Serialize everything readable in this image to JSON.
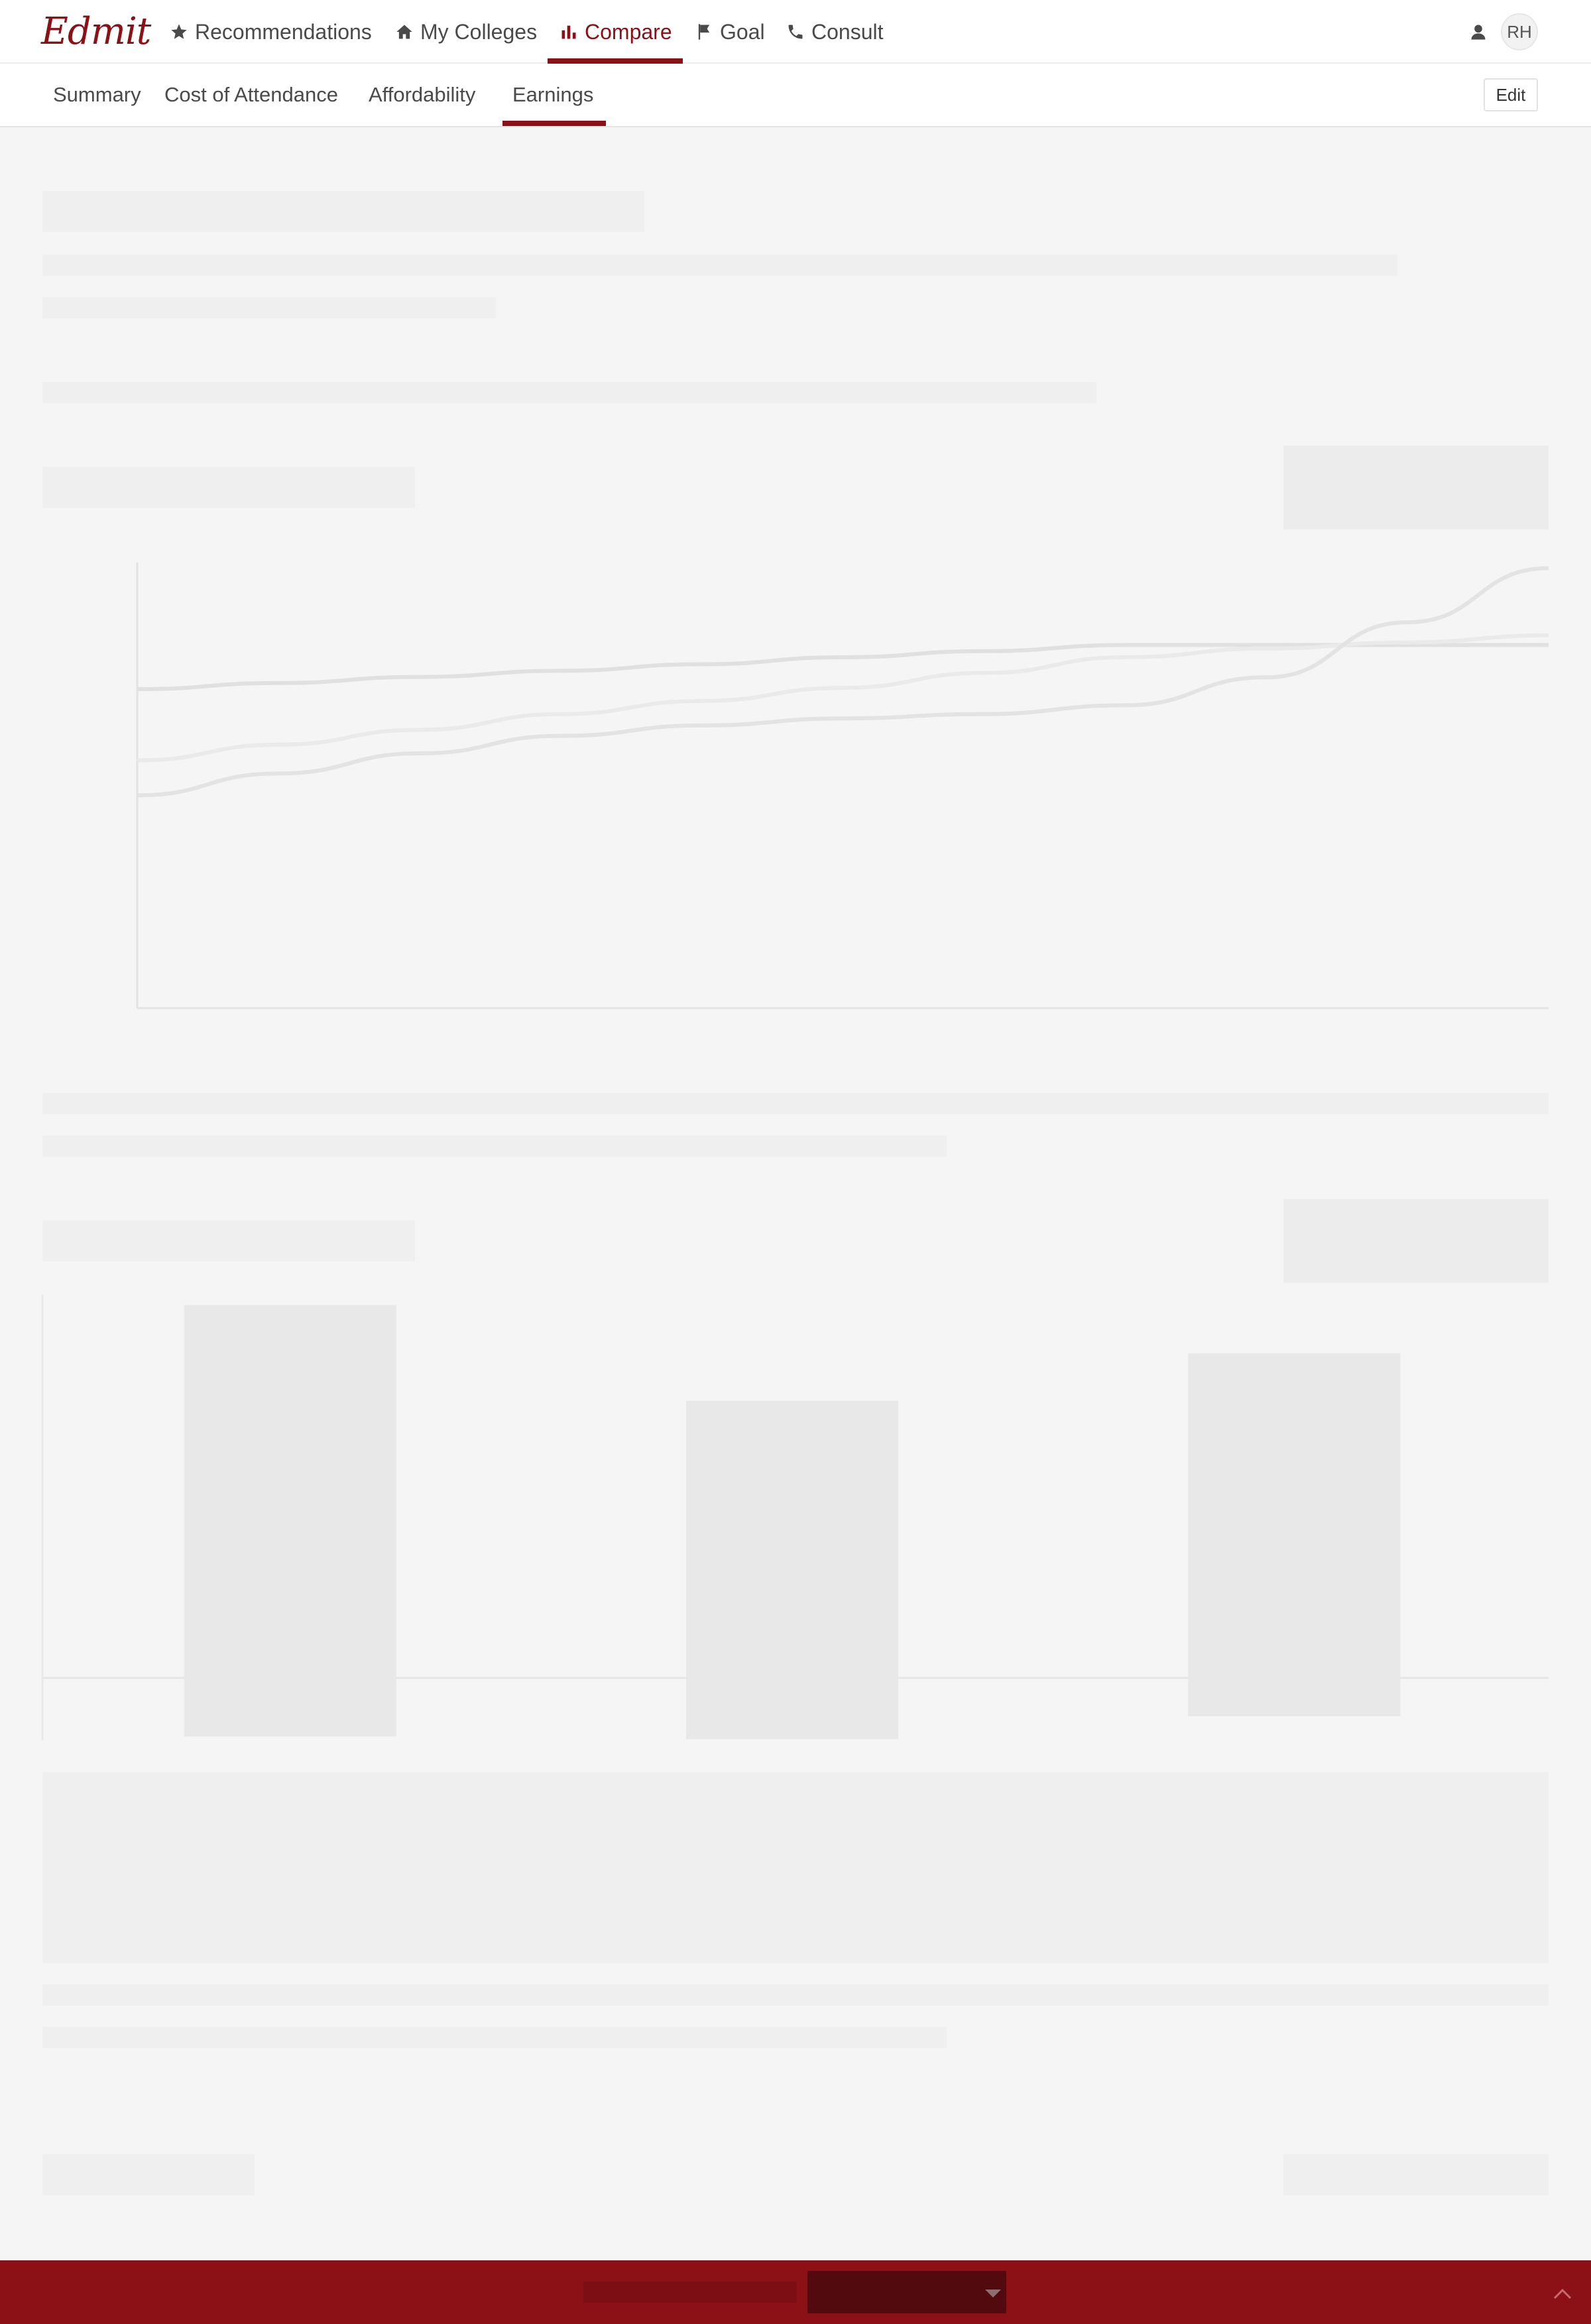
{
  "app": {
    "logo_text": "Edmit"
  },
  "topnav": {
    "items": [
      {
        "label": "Recommendations",
        "icon": "star-icon"
      },
      {
        "label": "My Colleges",
        "icon": "home-icon"
      },
      {
        "label": "Compare",
        "icon": "bar-chart-icon",
        "active": true
      },
      {
        "label": "Goal",
        "icon": "flag-icon"
      },
      {
        "label": "Consult",
        "icon": "phone-icon"
      }
    ],
    "user_initials": "RH"
  },
  "subnav": {
    "tabs": [
      {
        "label": "Summary"
      },
      {
        "label": "Cost of Attendance"
      },
      {
        "label": "Affordability"
      },
      {
        "label": "Earnings",
        "active": true
      }
    ],
    "edit_label": "Edit"
  },
  "colors": {
    "brand": "#8b1116",
    "background": "#f5f5f5",
    "skeleton": "#efefef"
  },
  "chart_data": [
    {
      "type": "line",
      "state": "loading-skeleton",
      "x": [
        0,
        1,
        2,
        3,
        4,
        5,
        6,
        7,
        8,
        9,
        10
      ],
      "series": [
        {
          "values": [
            53,
            54.4,
            55.8,
            57.2,
            58.7,
            60.3,
            61.7,
            63.1,
            63.1,
            63.1,
            63.1
          ]
        },
        {
          "values": [
            36.7,
            40.3,
            43.7,
            47.3,
            50.3,
            53.3,
            56.7,
            60.3,
            62.3,
            63.7,
            65.3
          ]
        },
        {
          "values": [
            28.7,
            33.7,
            38.3,
            42.3,
            44.7,
            46.3,
            47.3,
            49.3,
            55.7,
            68.3,
            80.7
          ]
        }
      ],
      "ylim": [
        -20,
        82
      ]
    },
    {
      "type": "bar",
      "state": "loading-skeleton",
      "categories": [
        "",
        "",
        ""
      ],
      "values": [
        97.3,
        72.3,
        84.7
      ],
      "baseline_values": [
        -15.3,
        -16,
        -10
      ],
      "ylim": [
        -16.3,
        100
      ]
    }
  ]
}
